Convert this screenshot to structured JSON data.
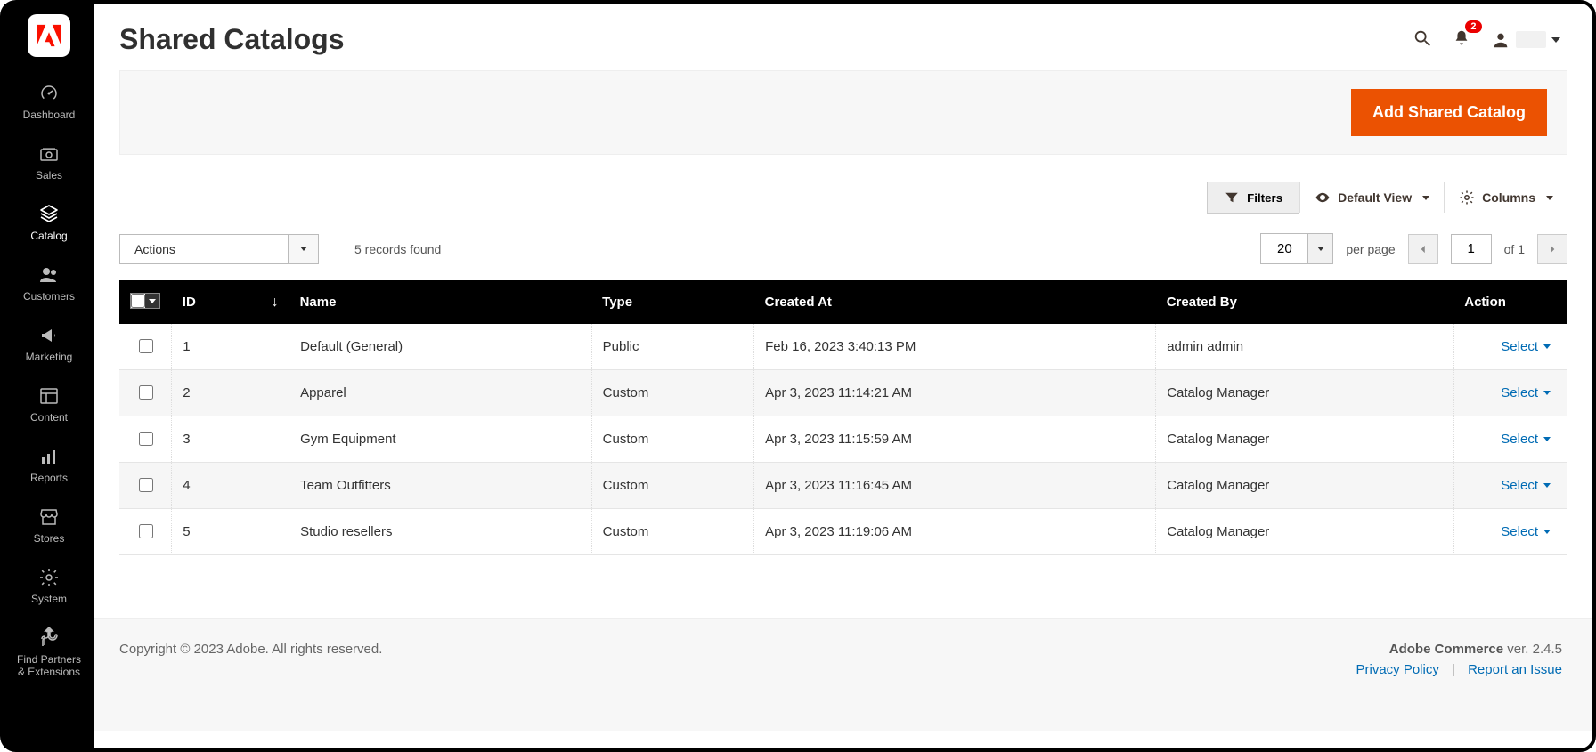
{
  "page_title": "Shared Catalogs",
  "header": {
    "notifications_count": "2"
  },
  "sidebar": {
    "items": [
      {
        "label": "Dashboard"
      },
      {
        "label": "Sales"
      },
      {
        "label": "Catalog"
      },
      {
        "label": "Customers"
      },
      {
        "label": "Marketing"
      },
      {
        "label": "Content"
      },
      {
        "label": "Reports"
      },
      {
        "label": "Stores"
      },
      {
        "label": "System"
      },
      {
        "label": "Find Partners\n& Extensions"
      }
    ]
  },
  "actions": {
    "add_button": "Add Shared Catalog",
    "filters": "Filters",
    "default_view": "Default View",
    "columns": "Columns",
    "actions_dropdown": "Actions",
    "records_found": "5 records found",
    "page_size": "20",
    "per_page": "per page",
    "page_current": "1",
    "page_of": "of 1"
  },
  "table": {
    "headers": {
      "id": "ID",
      "name": "Name",
      "type": "Type",
      "created_at": "Created At",
      "created_by": "Created By",
      "action": "Action"
    },
    "action_select_label": "Select",
    "rows": [
      {
        "id": "1",
        "name": "Default (General)",
        "type": "Public",
        "created_at": "Feb 16, 2023 3:40:13 PM",
        "created_by": "admin admin"
      },
      {
        "id": "2",
        "name": "Apparel",
        "type": "Custom",
        "created_at": "Apr 3, 2023 11:14:21 AM",
        "created_by": "Catalog Manager"
      },
      {
        "id": "3",
        "name": "Gym Equipment",
        "type": "Custom",
        "created_at": "Apr 3, 2023 11:15:59 AM",
        "created_by": "Catalog Manager"
      },
      {
        "id": "4",
        "name": "Team Outfitters",
        "type": "Custom",
        "created_at": "Apr 3, 2023 11:16:45 AM",
        "created_by": "Catalog Manager"
      },
      {
        "id": "5",
        "name": "Studio resellers",
        "type": "Custom",
        "created_at": "Apr 3, 2023 11:19:06 AM",
        "created_by": "Catalog Manager"
      }
    ]
  },
  "footer": {
    "copyright": "Copyright © 2023 Adobe. All rights reserved.",
    "product": "Adobe Commerce",
    "ver_label": " ver. 2.4.5",
    "privacy": "Privacy Policy",
    "report": "Report an Issue"
  }
}
